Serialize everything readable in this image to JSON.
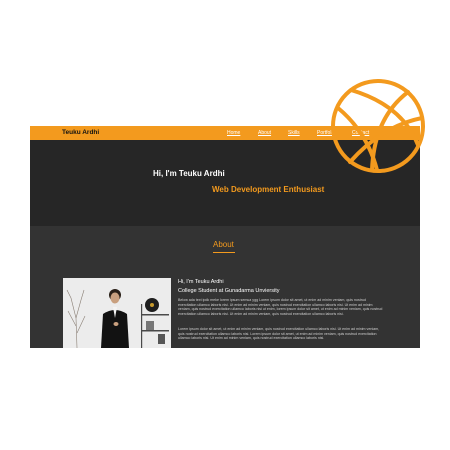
{
  "navbar": {
    "brand": "Teuku Ardhi",
    "links": [
      "Home",
      "About",
      "Skills",
      "Portfolio",
      "Contact"
    ]
  },
  "hero": {
    "title": "Hi, I'm Teuku Ardhi",
    "subtitle": "Web Development Enthusiast"
  },
  "about": {
    "heading": "About",
    "greeting": "Hi, I'm Teuku Ardhi",
    "role": "College Student at Gunadarma Unviersity",
    "paragraph_1": "Below ada text ipdk meke lorem ipsum semua ygg Lorem ipsum dolor sit amet, ut enim ad minim veniam, quis nostrud exercitation ullamco laboris nisi. Ut enim ad minim veniam, quis nostrud exercitation ullamco laboris nisi. Ut enim ad minim veniam, quis nostrud exercitation ullamco laboris nisi ut enim, lorem ipsum dolor sit amet, ut enim ad minim veniam, quis nostrud exercitation ullamco laboris nisi. Ut enim ad minim veniam, quis nostrud exercitation ullamco laboris nisi.",
    "paragraph_2": "Lorem ipsum dolor sit amet, ut enim ad minim veniam, quis nostrud exercitation ullamco laboris nisi. Ut enim ad minim veniam, quis nostrud exercitation ullamco laboris nisi. Lorem ipsum dolor sit amet, ut enim ad minim veniam, quis nostrud exercitation ullamco laboris nisi. Ut enim ad minim veniam, quis nostrud exercitation ullamco laboris nisi."
  },
  "colors": {
    "accent": "#f39a1e",
    "hero_bg": "#262626",
    "section_bg": "#333333"
  },
  "icons": {
    "decoration": "globe-icon"
  }
}
